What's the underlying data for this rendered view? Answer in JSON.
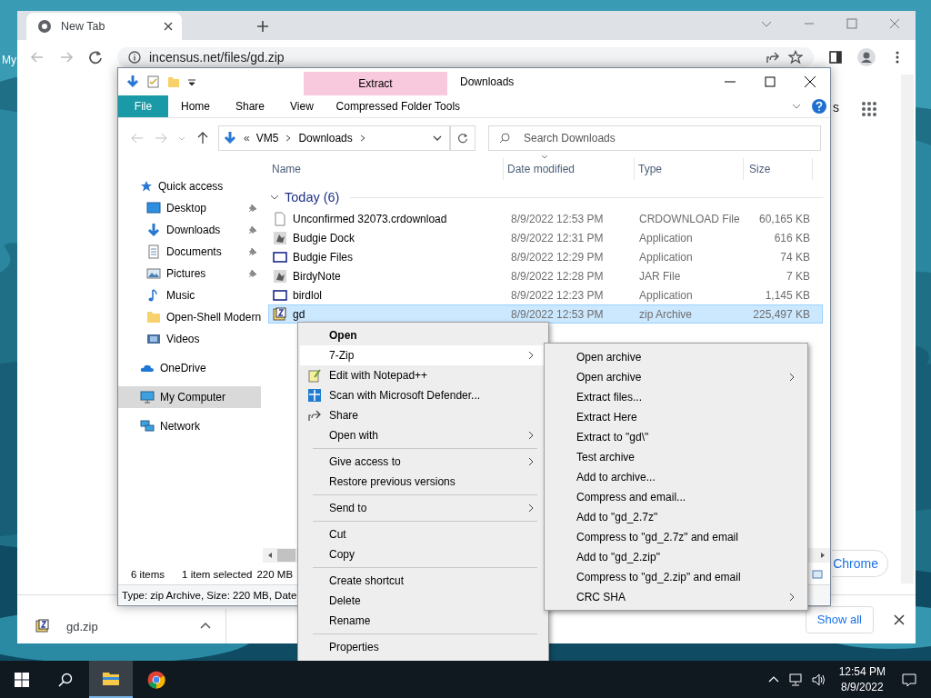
{
  "desktop": {
    "icon_label": "My"
  },
  "browser": {
    "tab": {
      "title": "New Tab",
      "selected": true
    },
    "url": "incensus.net/files/gd.zip",
    "page_fragment": "s",
    "page_button": "Chrome",
    "download": {
      "file": "gd.zip",
      "show_all": "Show all"
    }
  },
  "explorer": {
    "contextual_tab": "Extract",
    "title": "Downloads",
    "ribbon_tabs": [
      {
        "label": "File",
        "selected": true
      },
      {
        "label": "Home",
        "selected": false
      },
      {
        "label": "Share",
        "selected": false
      },
      {
        "label": "View",
        "selected": false
      },
      {
        "label": "Compressed Folder Tools",
        "selected": false
      }
    ],
    "path_overflow": "«",
    "path": [
      "VM5",
      "Downloads"
    ],
    "search_placeholder": "Search Downloads",
    "navigation": [
      {
        "label": "Quick access",
        "selected": false,
        "children": [
          {
            "label": "Desktop",
            "pinned": true,
            "selected": false
          },
          {
            "label": "Downloads",
            "pinned": true,
            "selected": false
          },
          {
            "label": "Documents",
            "pinned": true,
            "selected": false
          },
          {
            "label": "Pictures",
            "pinned": true,
            "selected": false
          },
          {
            "label": "Music",
            "pinned": false,
            "selected": false
          },
          {
            "label": "Open-Shell Modern",
            "pinned": false,
            "selected": false
          },
          {
            "label": "Videos",
            "pinned": false,
            "selected": false
          }
        ]
      },
      {
        "label": "OneDrive",
        "selected": false
      },
      {
        "label": "My Computer",
        "selected": true
      },
      {
        "label": "Network",
        "selected": false
      }
    ],
    "columns": [
      "Name",
      "Date modified",
      "Type",
      "Size"
    ],
    "group": "Today (6)",
    "rows": [
      {
        "name": "Unconfirmed 32073.crdownload",
        "date": "8/9/2022 12:53 PM",
        "type": "CRDOWNLOAD File",
        "size": "60,165 KB",
        "selected": false
      },
      {
        "name": "Budgie Dock",
        "date": "8/9/2022 12:31 PM",
        "type": "Application",
        "size": "616 KB",
        "selected": false
      },
      {
        "name": "Budgie Files",
        "date": "8/9/2022 12:29 PM",
        "type": "Application",
        "size": "74 KB",
        "selected": false
      },
      {
        "name": "BirdyNote",
        "date": "8/9/2022 12:28 PM",
        "type": "JAR File",
        "size": "7 KB",
        "selected": false
      },
      {
        "name": "birdlol",
        "date": "8/9/2022 12:23 PM",
        "type": "Application",
        "size": "1,145 KB",
        "selected": false
      },
      {
        "name": "gd",
        "date": "8/9/2022 12:53 PM",
        "type": "zip Archive",
        "size": "225,497 KB",
        "selected": true
      }
    ],
    "status": {
      "count": "6 items",
      "selection": "1 item selected",
      "selection_size": "220 MB"
    },
    "details": "Type: zip Archive, Size: 220 MB, Date"
  },
  "context_menu": [
    {
      "label": "Open",
      "default": true,
      "selected": false,
      "submenu": false,
      "separator_before": false
    },
    {
      "label": "7-Zip",
      "default": false,
      "selected": true,
      "submenu": true,
      "separator_before": false
    },
    {
      "label": "Edit with Notepad++",
      "default": false,
      "selected": false,
      "submenu": false,
      "separator_before": false
    },
    {
      "label": "Scan with Microsoft Defender...",
      "default": false,
      "selected": false,
      "submenu": false,
      "separator_before": false
    },
    {
      "label": "Share",
      "default": false,
      "selected": false,
      "submenu": false,
      "separator_before": false
    },
    {
      "label": "Open with",
      "default": false,
      "selected": false,
      "submenu": true,
      "separator_before": false
    },
    {
      "label": "Give access to",
      "default": false,
      "selected": false,
      "submenu": true,
      "separator_before": true
    },
    {
      "label": "Restore previous versions",
      "default": false,
      "selected": false,
      "submenu": false,
      "separator_before": false
    },
    {
      "label": "Send to",
      "default": false,
      "selected": false,
      "submenu": true,
      "separator_before": true
    },
    {
      "label": "Cut",
      "default": false,
      "selected": false,
      "submenu": false,
      "separator_before": true
    },
    {
      "label": "Copy",
      "default": false,
      "selected": false,
      "submenu": false,
      "separator_before": false
    },
    {
      "label": "Create shortcut",
      "default": false,
      "selected": false,
      "submenu": false,
      "separator_before": true
    },
    {
      "label": "Delete",
      "default": false,
      "selected": false,
      "submenu": false,
      "separator_before": false
    },
    {
      "label": "Rename",
      "default": false,
      "selected": false,
      "submenu": false,
      "separator_before": false
    },
    {
      "label": "Properties",
      "default": false,
      "selected": false,
      "submenu": false,
      "separator_before": true
    }
  ],
  "submenu": [
    {
      "label": "Open archive",
      "submenu": false
    },
    {
      "label": "Open archive",
      "submenu": true
    },
    {
      "label": "Extract files...",
      "submenu": false
    },
    {
      "label": "Extract Here",
      "submenu": false
    },
    {
      "label": "Extract to \"gd\\\"",
      "submenu": false
    },
    {
      "label": "Test archive",
      "submenu": false
    },
    {
      "label": "Add to archive...",
      "submenu": false
    },
    {
      "label": "Compress and email...",
      "submenu": false
    },
    {
      "label": "Add to \"gd_2.7z\"",
      "submenu": false
    },
    {
      "label": "Compress to \"gd_2.7z\" and email",
      "submenu": false
    },
    {
      "label": "Add to \"gd_2.zip\"",
      "submenu": false
    },
    {
      "label": "Compress to \"gd_2.zip\" and email",
      "submenu": false
    },
    {
      "label": "CRC SHA",
      "submenu": true
    }
  ],
  "taskbar": {
    "apps": [
      {
        "kind": "explorer",
        "active": true
      },
      {
        "kind": "chrome",
        "active": false
      }
    ],
    "time": "12:54 PM",
    "date": "8/9/2022"
  }
}
